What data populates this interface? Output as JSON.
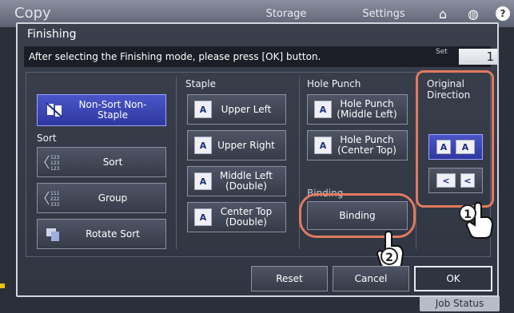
{
  "background": {
    "app_title": "Copy",
    "tabs": [
      "Storage",
      "Settings"
    ],
    "icons": [
      "home-icon",
      "globe-icon",
      "help-icon"
    ],
    "help_glyph": "?",
    "job_status": "Job Status"
  },
  "dialog": {
    "title": "Finishing",
    "instruction": "After selecting the Finishing mode, please press [OK] button.",
    "set_label": "Set",
    "set_value": "1"
  },
  "sections": {
    "sort_label": "Sort",
    "staple_label": "Staple",
    "hole_punch_label": "Hole Punch",
    "binding_label": "Binding",
    "original_direction_label": "Original Direction"
  },
  "buttons": {
    "non_sort": "Non-Sort Non-Staple",
    "sort": "Sort",
    "group": "Group",
    "rotate_sort": "Rotate Sort",
    "upper_left": "Upper Left",
    "upper_right": "Upper Right",
    "middle_left": "Middle Left (Double)",
    "center_top": "Center Top (Double)",
    "hp_middle_left": "Hole Punch (Middle Left)",
    "hp_center_top": "Hole Punch (Center Top)",
    "binding": "Binding",
    "reset": "Reset",
    "cancel": "Cancel",
    "ok": "OK"
  },
  "callouts": {
    "one": "1",
    "two": "2"
  },
  "colors": {
    "highlight": "#e07a5f",
    "selected": "#3a46b8"
  }
}
